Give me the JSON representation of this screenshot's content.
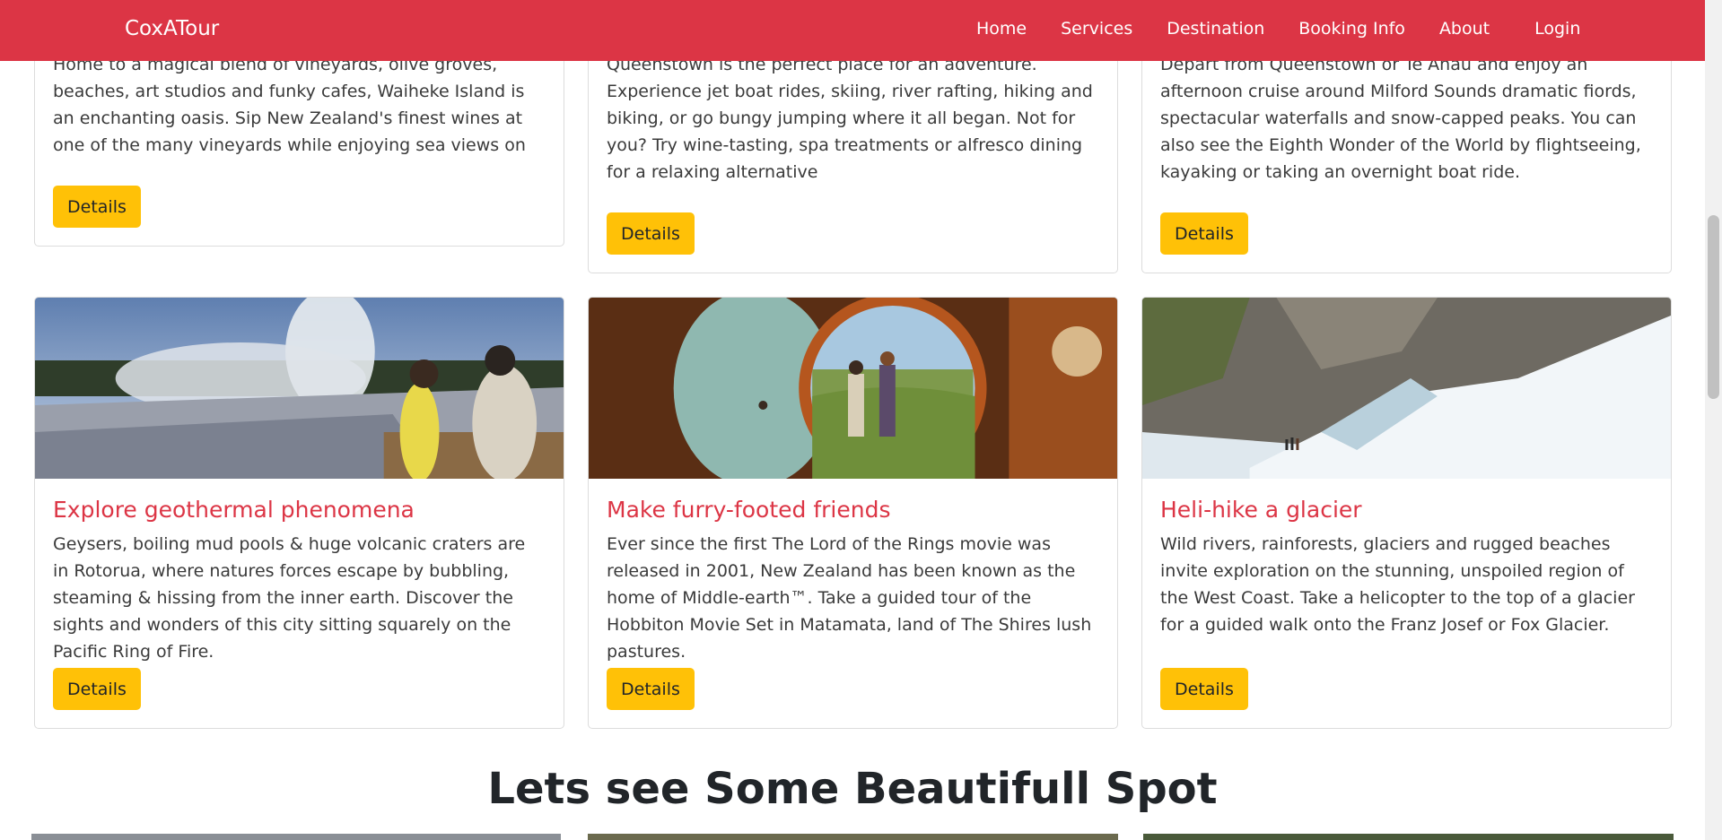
{
  "navbar": {
    "brand": "CoxATour",
    "links": [
      "Home",
      "Services",
      "Destination",
      "Booking Info",
      "About"
    ],
    "login": "Login",
    "color": "#dc3545"
  },
  "cards_top": [
    {
      "text": "Home to a magical blend of vineyards, olive groves, beaches, art studios and funky cafes, Waiheke Island is an enchanting oasis. Sip New Zealand's finest wines at one of the many vineyards while enjoying sea views on",
      "button": "Details"
    },
    {
      "text": "Queenstown is the perfect place for an adventure. Experience jet boat rides, skiing, river rafting, hiking and biking, or go bungy jumping where it all began. Not for you? Try wine-tasting, spa treatments or alfresco dining for a relaxing alternative",
      "button": "Details"
    },
    {
      "text": "Depart from Queenstown or Te Anau and enjoy an afternoon cruise around Milford Sounds dramatic fiords, spectacular waterfalls and snow-capped peaks. You can also see the Eighth Wonder of the World by flightseeing, kayaking or taking an overnight boat ride.",
      "button": "Details"
    }
  ],
  "cards_bottom": [
    {
      "title": "Explore geothermal phenomena",
      "text": "Geysers, boiling mud pools & huge volcanic craters are in Rotorua, where natures forces escape by bubbling, steaming & hissing from the inner earth. Discover the sights and wonders of this city sitting squarely on the Pacific Ring of Fire.",
      "button": "Details"
    },
    {
      "title": "Make furry-footed friends",
      "text": "Ever since the first The Lord of the Rings movie was released in 2001, New Zealand has been known as the home of Middle-earth™. Take a guided tour of the Hobbiton Movie Set in Matamata, land of The Shires lush pastures.",
      "button": "Details"
    },
    {
      "title": "Heli-hike a glacier",
      "text": "Wild rivers, rainforests, glaciers and rugged beaches invite exploration on the stunning, unspoiled region of the West Coast. Take a helicopter to the top of a glacier for a guided walk onto the Franz Josef or Fox Glacier.",
      "button": "Details"
    }
  ],
  "section_title": "Lets see Some Beautifull Spot",
  "colors": {
    "accent": "#dc3545",
    "button": "#ffc107"
  }
}
